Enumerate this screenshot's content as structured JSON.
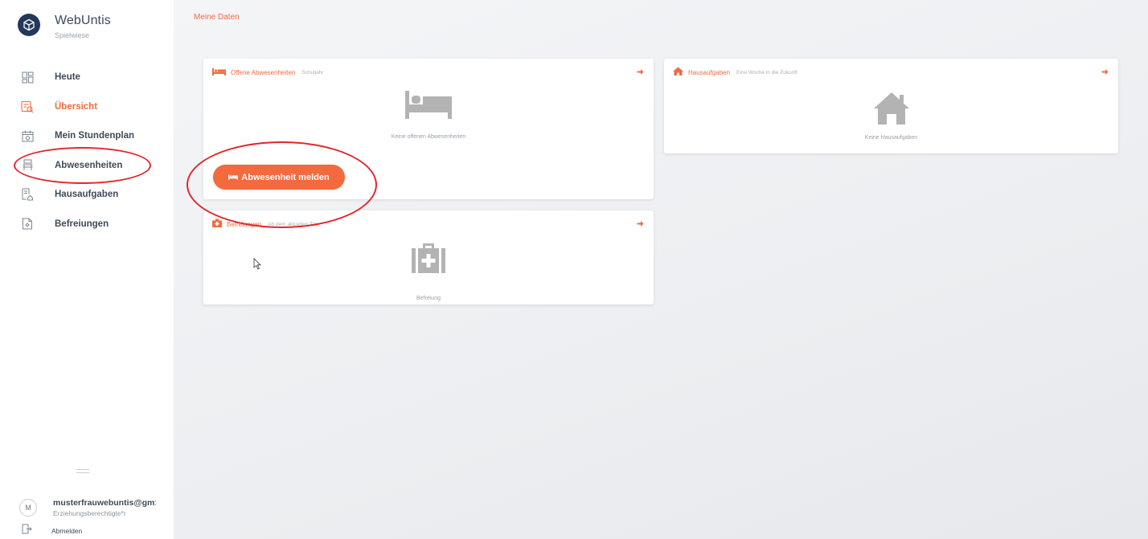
{
  "brand": {
    "name": "WebUntis",
    "subtitle": "Spielwiese"
  },
  "nav": [
    {
      "label": "Heute",
      "icon": "grid-icon"
    },
    {
      "label": "Übersicht",
      "icon": "overview-icon",
      "active": true
    },
    {
      "label": "Mein Stundenplan",
      "icon": "calendar-icon"
    },
    {
      "label": "Abwesenheiten",
      "icon": "absence-icon"
    },
    {
      "label": "Hausaufgaben",
      "icon": "homework-icon"
    },
    {
      "label": "Befreiungen",
      "icon": "exemption-icon"
    }
  ],
  "user": {
    "initial": "M",
    "email": "musterfrauwebuntis@gm:",
    "role": "Erziehungsberechtigte*r",
    "logout": "Abmelden"
  },
  "page": {
    "title": "Meine Daten"
  },
  "cards": {
    "absences": {
      "title": "Offene Abwesenheiten",
      "sub": "Schuljahr",
      "empty": "Keine offenen Abwesenheiten",
      "button": "Abwesenheit melden"
    },
    "homework": {
      "title": "Hausaufgaben",
      "sub": "Eine Woche in die Zukunft",
      "empty": "Keine Hausaufgaben"
    },
    "exemptions": {
      "title": "Befreiungen",
      "sub": "Ab dem aktuellen Tag",
      "empty": "Befreiung"
    }
  },
  "colors": {
    "accent": "#f26a3d",
    "annotation": "#e3262a",
    "brand": "#23385a"
  }
}
